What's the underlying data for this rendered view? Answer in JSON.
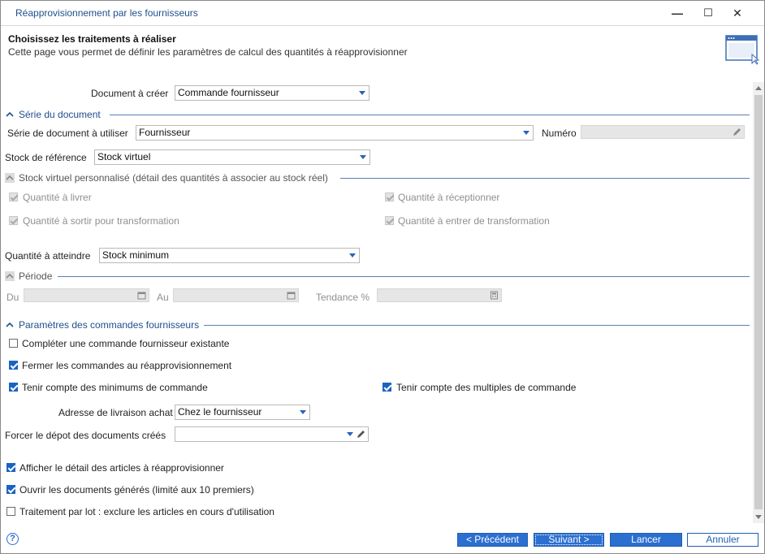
{
  "window": {
    "title": "Réapprovisionnement par les fournisseurs",
    "minimize": "—",
    "maximize": "☐",
    "close": "✕"
  },
  "header": {
    "title": "Choisissez les traitements à réaliser",
    "subtitle": "Cette page vous permet de définir les paramètres de calcul des quantités à réapprovisionner"
  },
  "form": {
    "document_label": "Document à créer",
    "document_value": "Commande fournisseur",
    "serie_section": "Série du document",
    "serie_label": "Série de document à utiliser",
    "serie_value": "Fournisseur",
    "numero_label": "Numéro",
    "stock_label": "Stock de référence",
    "stock_value": "Stock virtuel",
    "virtuel_section": "Stock virtuel personnalisé (détail des quantités à associer au stock réel)",
    "qte_livrer": "Quantité à livrer",
    "qte_receptionner": "Quantité à réceptionner",
    "qte_sortir": "Quantité à sortir pour transformation",
    "qte_entrer": "Quantité à entrer de transformation",
    "qte_atteindre_label": "Quantité à atteindre",
    "qte_atteindre_value": "Stock minimum",
    "periode_section": "Période",
    "du_label": "Du",
    "au_label": "Au",
    "tendance_label": "Tendance %",
    "params_section": "Paramètres des commandes fournisseurs",
    "completer": "Compléter une commande fournisseur existante",
    "fermer": "Fermer les commandes au réapprovisionnement",
    "minimums": "Tenir compte des minimums de commande",
    "multiples": "Tenir compte des multiples de commande",
    "adresse_label": "Adresse de livraison achat",
    "adresse_value": "Chez le fournisseur",
    "depot_label": "Forcer le dépot des documents créés",
    "afficher": "Afficher le détail des articles à réapprovisionner",
    "ouvrir": "Ouvrir les documents générés (limité aux 10 premiers)",
    "lot": "Traitement par lot : exclure les articles en cours d'utilisation"
  },
  "checks": {
    "completer": false,
    "fermer": true,
    "minimums": true,
    "multiples": true,
    "afficher": true,
    "ouvrir": true,
    "lot": false
  },
  "buttons": {
    "help": "?",
    "precedent": "< Précédent",
    "suivant": "Suivant >",
    "lancer": "Lancer",
    "annuler": "Annuler"
  },
  "colors": {
    "accent": "#2b6fd0",
    "title_text": "#1f4e8c",
    "section_line": "#5b7fb4"
  }
}
